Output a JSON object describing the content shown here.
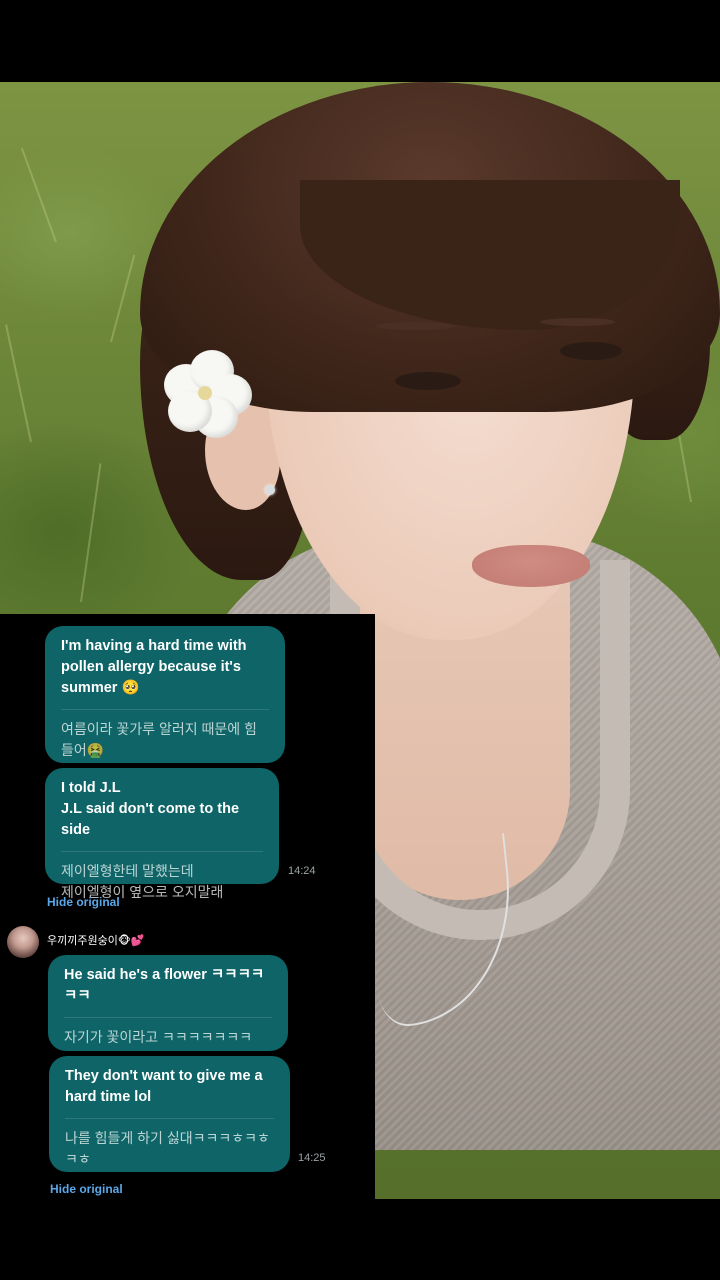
{
  "chat": {
    "messages_group_1": [
      {
        "original": "I'm having a hard time with pollen allergy because it's summer 🥺",
        "translation": "여름이라 꽃가루 알러지 때문에 힘들어🤮"
      },
      {
        "original": "I told J.L\nJ.L said don't come to the side",
        "translation": "제이엘형한테 말했는데\n제이엘형이 옆으로 오지말래"
      }
    ],
    "time_1": "14:24",
    "hide_original_1": "Hide original",
    "sender_name": "우끼끼주원숭이🐵💕",
    "messages_group_2": [
      {
        "original": "He said he's a flower ㅋㅋㅋㅋㅋㅋ",
        "translation": "자기가 꽃이라고 ㅋㅋㅋㅋㅋㅋㅋ"
      },
      {
        "original": "They don't want to give me a hard time lol",
        "translation": "나를 힘들게 하기 싫대ㅋㅋㅋㅎㅋㅎㅋㅎ"
      }
    ],
    "time_2": "14:25",
    "hide_original_2": "Hide original"
  },
  "colors": {
    "bubble": "#0e6467",
    "link": "#5aa8ea",
    "background": "#000000"
  },
  "icons": {
    "avatar": "profile-photo"
  }
}
